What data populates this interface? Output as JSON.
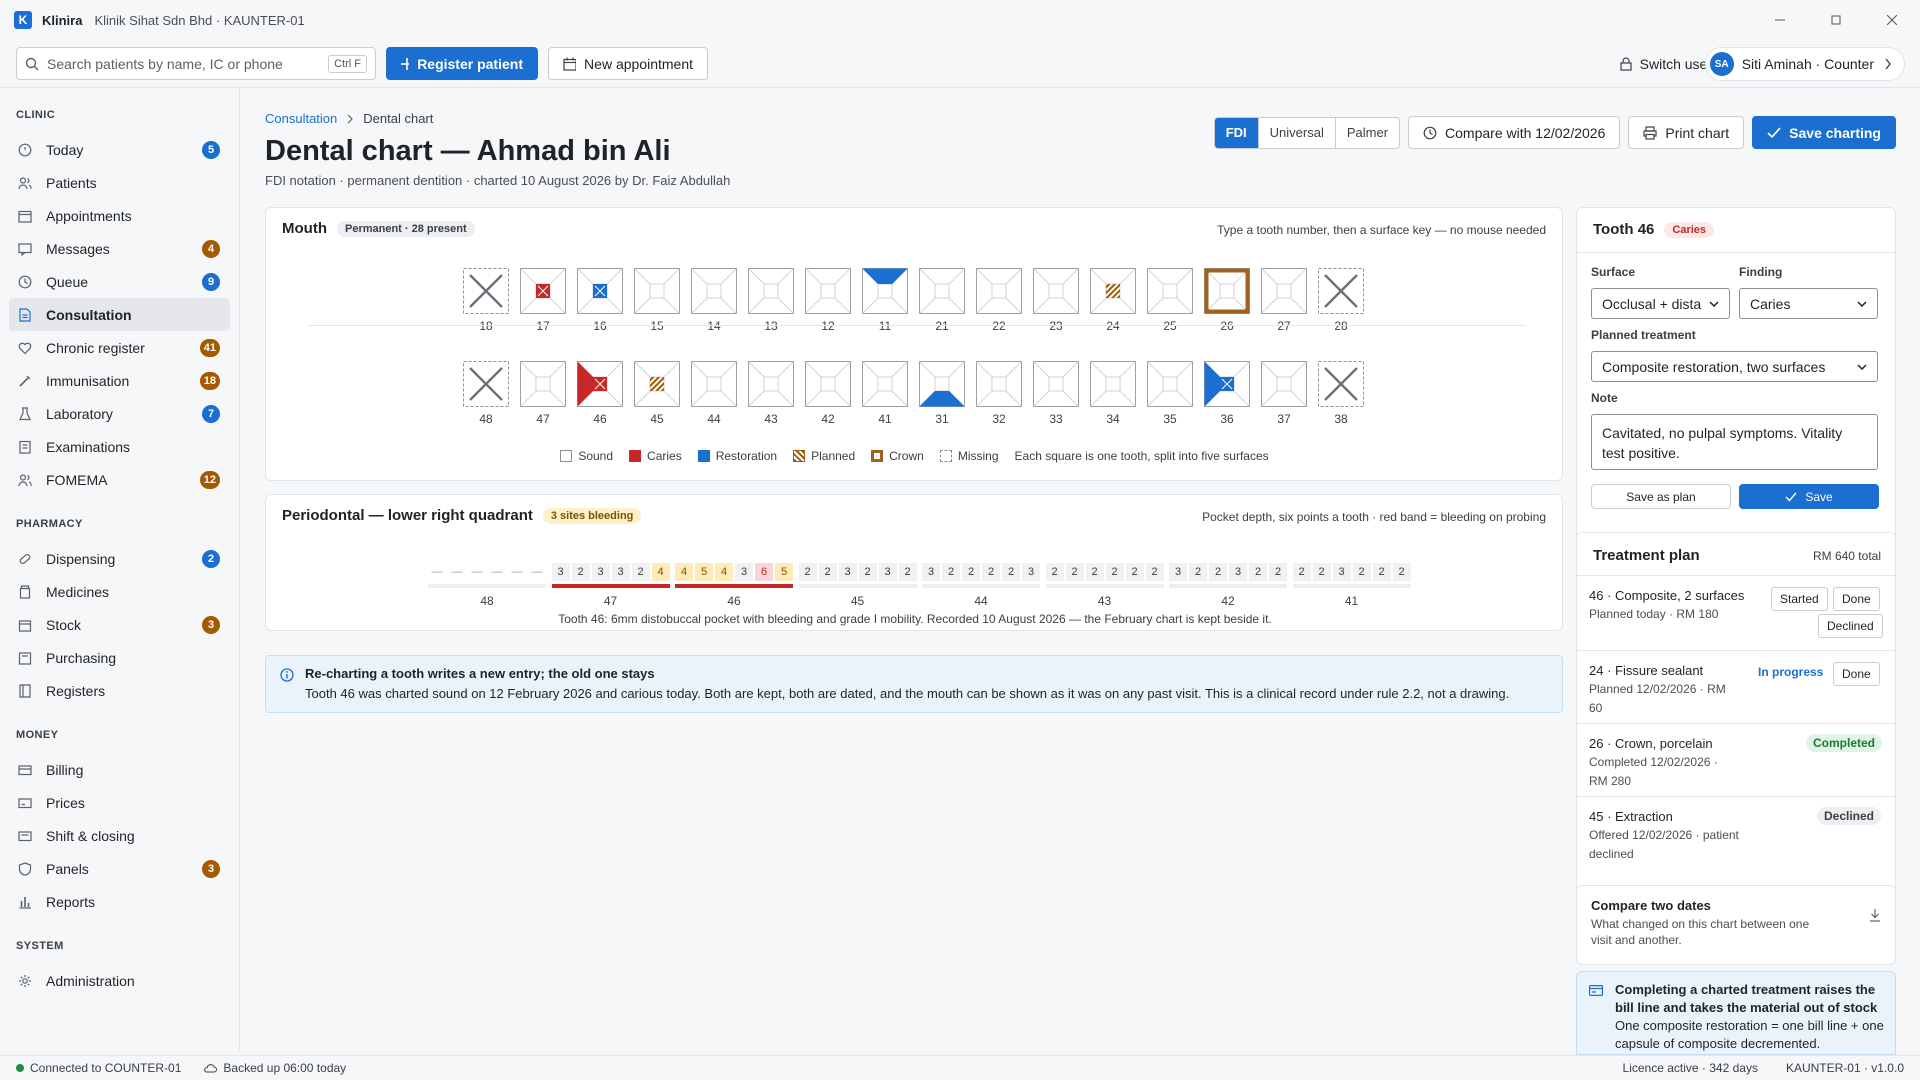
{
  "window": {
    "logo_letter": "K",
    "app_name": "Klinira",
    "subtitle": "Klinik Sihat Sdn Bhd · KAUNTER-01"
  },
  "toolbar": {
    "search_placeholder": "Search patients by name, IC or phone",
    "search_shortcut": "Ctrl F",
    "register_label": "Register patient",
    "new_appointment_label": "New appointment",
    "switch_user_label": "Switch user",
    "user_initials": "SA",
    "user_label": "Siti Aminah · Counter"
  },
  "sidebar": {
    "clinic_heading": "CLINIC",
    "clinic_items": [
      {
        "label": "Today",
        "badge": "5",
        "badge_color": "#1a6fd1"
      },
      {
        "label": "Patients"
      },
      {
        "label": "Appointments"
      },
      {
        "label": "Messages",
        "badge": "4",
        "badge_color": "#a35a00"
      },
      {
        "label": "Queue",
        "badge": "9",
        "badge_color": "#1a6fd1"
      },
      {
        "label": "Consultation",
        "active": true
      },
      {
        "label": "Chronic register",
        "badge": "41",
        "badge_color": "#a35a00"
      },
      {
        "label": "Immunisation",
        "badge": "18",
        "badge_color": "#a35a00"
      },
      {
        "label": "Laboratory",
        "badge": "7",
        "badge_color": "#1a6fd1"
      },
      {
        "label": "Examinations"
      },
      {
        "label": "FOMEMA",
        "badge": "12",
        "badge_color": "#a35a00"
      }
    ],
    "pharmacy_heading": "PHARMACY",
    "pharmacy_items": [
      {
        "label": "Dispensing",
        "badge": "2",
        "badge_color": "#1a6fd1"
      },
      {
        "label": "Medicines"
      },
      {
        "label": "Stock",
        "badge": "3",
        "badge_color": "#a35a00"
      },
      {
        "label": "Purchasing"
      },
      {
        "label": "Registers"
      }
    ],
    "money_heading": "MONEY",
    "money_items": [
      {
        "label": "Billing"
      },
      {
        "label": "Prices"
      },
      {
        "label": "Shift & closing"
      },
      {
        "label": "Panels",
        "badge": "3",
        "badge_color": "#a35a00"
      },
      {
        "label": "Reports"
      }
    ],
    "system_heading": "SYSTEM",
    "system_items": [
      {
        "label": "Administration"
      }
    ]
  },
  "header": {
    "breadcrumb_root": "Consultation",
    "breadcrumb_current": "Dental chart",
    "title": "Dental chart — Ahmad bin Ali",
    "subtitle": "FDI notation · permanent dentition · charted 10 August 2026 by Dr. Faiz Abdullah",
    "notation_options": [
      "FDI",
      "Universal",
      "Palmer"
    ],
    "notation_selected": "FDI",
    "compare_label": "Compare with 12/02/2026",
    "print_label": "Print chart",
    "save_label": "Save charting"
  },
  "mouth": {
    "title": "Mouth",
    "badge": "Permanent · 28 present",
    "hint": "Type a tooth number, then a surface key — no mouse needed",
    "upper": [
      {
        "n": "18",
        "state": "missing"
      },
      {
        "n": "17",
        "state": "caries-center"
      },
      {
        "n": "16",
        "state": "restoration-center"
      },
      {
        "n": "15",
        "state": "sound"
      },
      {
        "n": "14",
        "state": "sound"
      },
      {
        "n": "13",
        "state": "sound"
      },
      {
        "n": "12",
        "state": "sound"
      },
      {
        "n": "11",
        "state": "restoration-top"
      },
      {
        "n": "21",
        "state": "sound"
      },
      {
        "n": "22",
        "state": "sound"
      },
      {
        "n": "23",
        "state": "sound"
      },
      {
        "n": "24",
        "state": "planned-center"
      },
      {
        "n": "25",
        "state": "sound"
      },
      {
        "n": "26",
        "state": "crown"
      },
      {
        "n": "27",
        "state": "sound"
      },
      {
        "n": "28",
        "state": "missing"
      }
    ],
    "lower": [
      {
        "n": "48",
        "state": "missing"
      },
      {
        "n": "47",
        "state": "sound"
      },
      {
        "n": "46",
        "state": "caries-left-center"
      },
      {
        "n": "45",
        "state": "planned-center"
      },
      {
        "n": "44",
        "state": "sound"
      },
      {
        "n": "43",
        "state": "sound"
      },
      {
        "n": "42",
        "state": "sound"
      },
      {
        "n": "41",
        "state": "sound"
      },
      {
        "n": "31",
        "state": "restoration-bottom"
      },
      {
        "n": "32",
        "state": "sound"
      },
      {
        "n": "33",
        "state": "sound"
      },
      {
        "n": "34",
        "state": "sound"
      },
      {
        "n": "35",
        "state": "sound"
      },
      {
        "n": "36",
        "state": "restoration-left-center"
      },
      {
        "n": "37",
        "state": "sound"
      },
      {
        "n": "38",
        "state": "missing"
      }
    ],
    "legend": {
      "sound": "Sound",
      "caries": "Caries",
      "restoration": "Restoration",
      "planned": "Planned",
      "crown": "Crown",
      "missing": "Missing",
      "note": "Each square is one tooth, split into five surfaces"
    },
    "colors": {
      "caries": "#c62828",
      "restoration": "#1a6fd1",
      "planned": "#a35a00",
      "crown": "#a0631c"
    }
  },
  "perio": {
    "title": "Periodontal — lower right quadrant",
    "badge": "3 sites bleeding",
    "hint": "Pocket depth, six points a tooth · red band = bleeding on probing",
    "teeth": [
      {
        "n": "48",
        "values": [
          "—",
          "—",
          "—",
          "—",
          "—",
          "—"
        ],
        "bleeding": false
      },
      {
        "n": "47",
        "values": [
          "3",
          "2",
          "3",
          "3",
          "2",
          "4"
        ],
        "bleeding": true
      },
      {
        "n": "46",
        "values": [
          "4",
          "5",
          "4",
          "3",
          "6",
          "5"
        ],
        "bleeding": true
      },
      {
        "n": "45",
        "values": [
          "2",
          "2",
          "3",
          "2",
          "3",
          "2"
        ],
        "bleeding": false
      },
      {
        "n": "44",
        "values": [
          "3",
          "2",
          "2",
          "2",
          "2",
          "3"
        ],
        "bleeding": false
      },
      {
        "n": "43",
        "values": [
          "2",
          "2",
          "2",
          "2",
          "2",
          "2"
        ],
        "bleeding": false
      },
      {
        "n": "42",
        "values": [
          "3",
          "2",
          "2",
          "3",
          "2",
          "2"
        ],
        "bleeding": false
      },
      {
        "n": "41",
        "values": [
          "2",
          "2",
          "3",
          "2",
          "2",
          "2"
        ],
        "bleeding": false
      }
    ],
    "note": "Tooth 46: 6mm distobuccal pocket with bleeding and grade I mobility. Recorded 10 August 2026 — the February chart is kept beside it."
  },
  "info": {
    "title": "Re-charting a tooth writes a new entry; the old one stays",
    "body": "Tooth 46 was charted sound on 12 February 2026 and carious today. Both are kept, both are dated, and the mouth can be shown as it was on any past visit. This is a clinical record under rule 2.2, not a drawing."
  },
  "tooth_panel": {
    "title": "Tooth 46",
    "badge": "Caries",
    "surface_label": "Surface",
    "surface_value": "Occlusal + dista",
    "finding_label": "Finding",
    "finding_value": "Caries",
    "treatment_label": "Planned treatment",
    "treatment_value": "Composite restoration, two surfaces",
    "note_label": "Note",
    "note_value": "Cavitated, no pulpal symptoms. Vitality test positive.",
    "save_plan_label": "Save as plan",
    "save_label": "Save"
  },
  "plan": {
    "title": "Treatment plan",
    "total": "RM 640 total",
    "items": [
      {
        "title": "46 · Composite, 2 surfaces",
        "meta": "Planned today · RM 180",
        "started": "Started",
        "done": "Done",
        "declined": "Declined"
      },
      {
        "title": "24 · Fissure sealant",
        "meta": "Planned 12/02/2026 · RM 60",
        "status": "In progress",
        "done": "Done"
      },
      {
        "title": "26 · Crown, porcelain",
        "meta": "Completed 12/02/2026 · RM 280",
        "status": "Completed"
      },
      {
        "title": "45 · Extraction",
        "meta": "Offered 12/02/2026 · patient declined",
        "status": "Declined"
      }
    ]
  },
  "compare": {
    "title": "Compare two dates",
    "body": "What changed on this chart between one visit and another."
  },
  "stock_notice": {
    "title": "Completing a charted treatment raises the bill line and takes the material out of stock",
    "body": "One composite restoration = one bill line + one capsule of composite decremented."
  },
  "status": {
    "connection": "Connected to COUNTER-01",
    "backup": "Backed up 06:00 today",
    "licence": "Licence active · 342 days",
    "version": "KAUNTER-01 · v1.0.0"
  }
}
